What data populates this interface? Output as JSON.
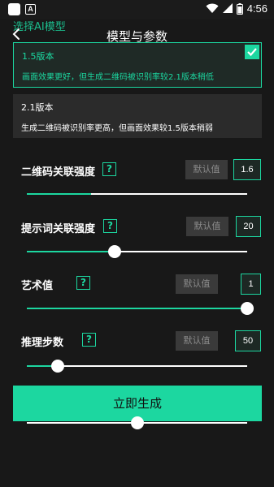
{
  "status_bar": {
    "time": "4:56",
    "icons": [
      "app-icon",
      "a-notification-icon",
      "wifi-icon",
      "signal-icon",
      "battery-icon"
    ]
  },
  "header": {
    "overlay_title": "选择AI模型",
    "title": "模型与参数",
    "back_icon": "chevron-left-icon"
  },
  "models": [
    {
      "name": "1.5版本",
      "description": "画面效果更好，但生成二维码被识别率较2.1版本稍低",
      "selected": true
    },
    {
      "name": "2.1版本",
      "description": "生成二维码被识别率更高，但画面效果较1.5版本稍弱",
      "selected": false
    }
  ],
  "params": [
    {
      "label": "二维码关联强度",
      "help": "?",
      "default_label": "默认值",
      "value": "1.6",
      "level": 0.29
    },
    {
      "label": "提示词关联强度",
      "help": "?",
      "default_label": "默认值",
      "value": "20",
      "level": 0.4
    },
    {
      "label": "艺术值",
      "help": "?",
      "default_label": "默认值",
      "value": "1",
      "level": 1.0
    },
    {
      "label": "推理步数",
      "help": "?",
      "default_label": "默认值",
      "value": "50",
      "level": 0.14
    }
  ],
  "generate_button": {
    "label": "立即生成",
    "stray_slider_level": 0.5
  },
  "colors": {
    "accent": "#1cd7a0",
    "background": "#181818",
    "card_unselected": "#2b2b2b",
    "default_button": "#3a3a3a"
  }
}
